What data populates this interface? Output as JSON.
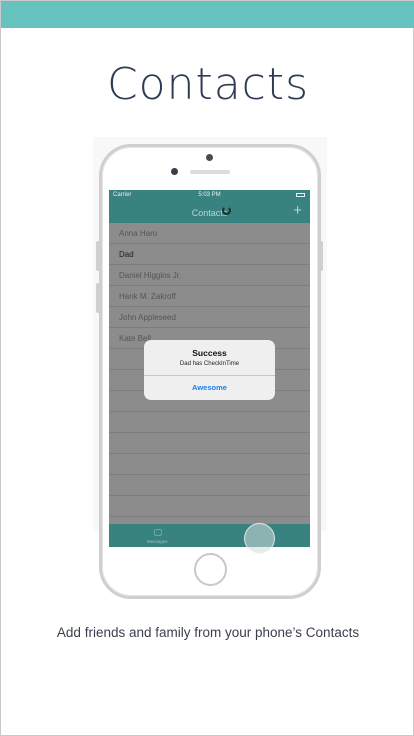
{
  "headline": "Contacts",
  "status_bar": {
    "carrier": "Carrier",
    "wifi_icon": "wifi-icon",
    "time": "5:03 PM",
    "battery_icon": "battery-icon"
  },
  "nav": {
    "title": "Contacts",
    "add_symbol": "+",
    "spinner_icon": "activity-spinner-icon"
  },
  "contacts": [
    {
      "name": "Anna Haro"
    },
    {
      "name": "Dad"
    },
    {
      "name": "Daniel Higgins Jr."
    },
    {
      "name": "Hank M. Zakroff"
    },
    {
      "name": "John Appleseed"
    },
    {
      "name": "Kate Bell"
    }
  ],
  "tab_bar": {
    "messages_label": "Messages",
    "messages_icon": "messages-icon"
  },
  "alert": {
    "title": "Success",
    "message": "Dad has CheckInTime",
    "button": "Awesome"
  },
  "caption": "Add friends and family from your phone’s Contacts",
  "colors": {
    "accent": "#66c2bd",
    "navbar": "#38827f",
    "link": "#1a7ff0",
    "text": "#2e3b52"
  }
}
